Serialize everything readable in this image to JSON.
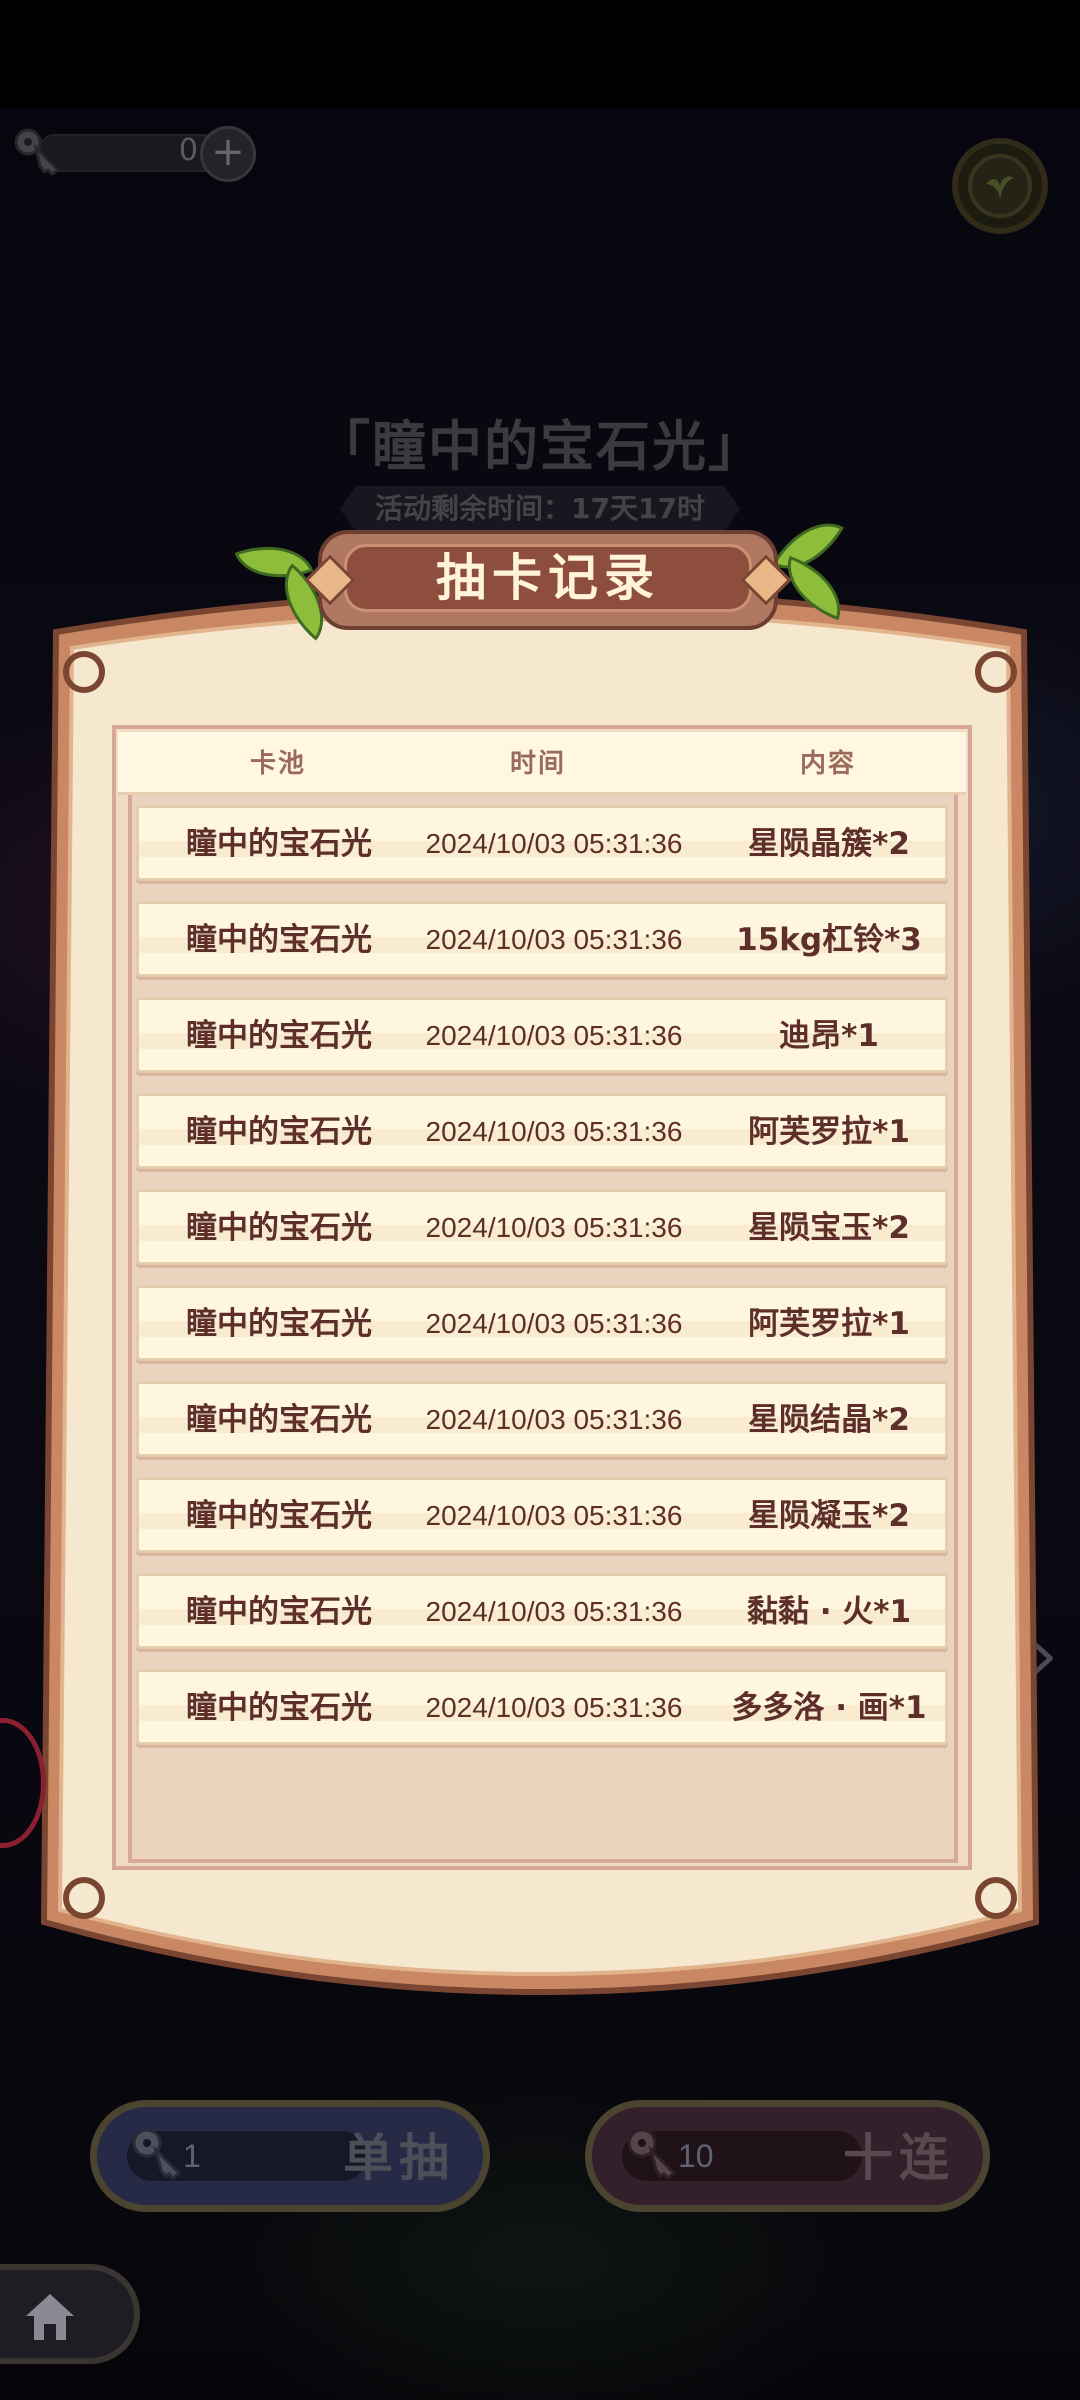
{
  "hud": {
    "key_count": "0",
    "plus_label": "+"
  },
  "event": {
    "title": "「瞳中的宝石光」",
    "remaining": "活动剩余时间：17天17时"
  },
  "dialog": {
    "title": "抽卡记录",
    "columns": [
      "卡池",
      "时间",
      "内容"
    ],
    "records": [
      {
        "pool": "瞳中的宝石光",
        "time": "2024/10/03 05:31:36",
        "content": "星陨晶簇*2"
      },
      {
        "pool": "瞳中的宝石光",
        "time": "2024/10/03 05:31:36",
        "content": "15kg杠铃*3"
      },
      {
        "pool": "瞳中的宝石光",
        "time": "2024/10/03 05:31:36",
        "content": "迪昂*1"
      },
      {
        "pool": "瞳中的宝石光",
        "time": "2024/10/03 05:31:36",
        "content": "阿芙罗拉*1"
      },
      {
        "pool": "瞳中的宝石光",
        "time": "2024/10/03 05:31:36",
        "content": "星陨宝玉*2"
      },
      {
        "pool": "瞳中的宝石光",
        "time": "2024/10/03 05:31:36",
        "content": "阿芙罗拉*1"
      },
      {
        "pool": "瞳中的宝石光",
        "time": "2024/10/03 05:31:36",
        "content": "星陨结晶*2"
      },
      {
        "pool": "瞳中的宝石光",
        "time": "2024/10/03 05:31:36",
        "content": "星陨凝玉*2"
      },
      {
        "pool": "瞳中的宝石光",
        "time": "2024/10/03 05:31:36",
        "content": "黏黏 · 火*1"
      },
      {
        "pool": "瞳中的宝石光",
        "time": "2024/10/03 05:31:36",
        "content": "多多洛 · 画*1"
      }
    ]
  },
  "buttons": {
    "single": {
      "count": "1",
      "label": "单抽"
    },
    "ten": {
      "count": "10",
      "label": "十连"
    }
  },
  "icons": {
    "key": "key-icon",
    "help": "leaf-help-icon",
    "home": "home-icon",
    "arrow": "chevron-right-icon"
  },
  "colors": {
    "panel_border": "#b97a5a",
    "panel_bg": "#f7ead2",
    "title_plate": "#8e4e3d",
    "row_text": "#5e2f2a"
  }
}
